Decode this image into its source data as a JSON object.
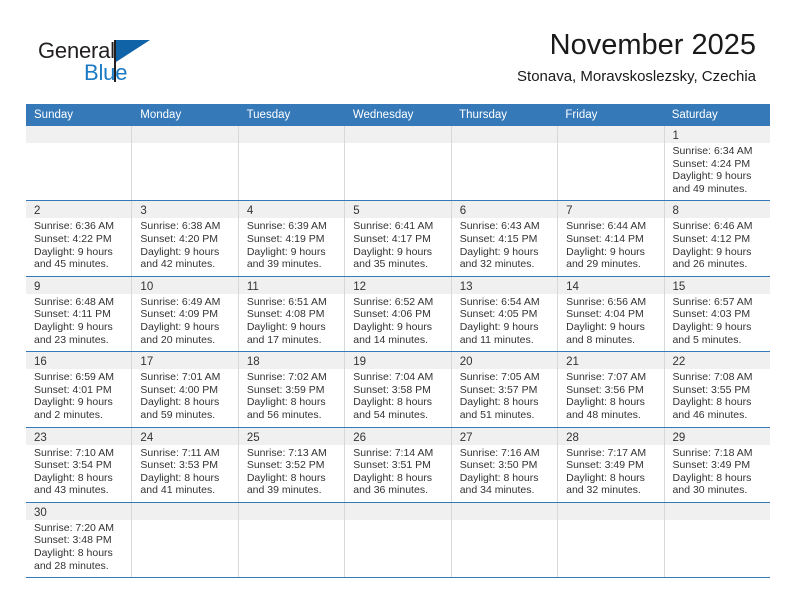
{
  "brand": {
    "name_line1": "General",
    "name_line2": "Blue",
    "primary_color": "#1163a8",
    "accent_color": "#1b7ac4"
  },
  "header": {
    "title": "November 2025",
    "subtitle": "Stonava, Moravskoslezsky, Czechia"
  },
  "calendar": {
    "header_bg": "#3579b8",
    "day_band_bg": "#f0f0f0",
    "weekdays": [
      "Sunday",
      "Monday",
      "Tuesday",
      "Wednesday",
      "Thursday",
      "Friday",
      "Saturday"
    ],
    "weeks": [
      [
        {
          "day": "",
          "empty": true
        },
        {
          "day": "",
          "empty": true
        },
        {
          "day": "",
          "empty": true
        },
        {
          "day": "",
          "empty": true
        },
        {
          "day": "",
          "empty": true
        },
        {
          "day": "",
          "empty": true
        },
        {
          "day": "1",
          "sunrise": "Sunrise: 6:34 AM",
          "sunset": "Sunset: 4:24 PM",
          "daylight_line1": "Daylight: 9 hours",
          "daylight_line2": "and 49 minutes."
        }
      ],
      [
        {
          "day": "2",
          "sunrise": "Sunrise: 6:36 AM",
          "sunset": "Sunset: 4:22 PM",
          "daylight_line1": "Daylight: 9 hours",
          "daylight_line2": "and 45 minutes."
        },
        {
          "day": "3",
          "sunrise": "Sunrise: 6:38 AM",
          "sunset": "Sunset: 4:20 PM",
          "daylight_line1": "Daylight: 9 hours",
          "daylight_line2": "and 42 minutes."
        },
        {
          "day": "4",
          "sunrise": "Sunrise: 6:39 AM",
          "sunset": "Sunset: 4:19 PM",
          "daylight_line1": "Daylight: 9 hours",
          "daylight_line2": "and 39 minutes."
        },
        {
          "day": "5",
          "sunrise": "Sunrise: 6:41 AM",
          "sunset": "Sunset: 4:17 PM",
          "daylight_line1": "Daylight: 9 hours",
          "daylight_line2": "and 35 minutes."
        },
        {
          "day": "6",
          "sunrise": "Sunrise: 6:43 AM",
          "sunset": "Sunset: 4:15 PM",
          "daylight_line1": "Daylight: 9 hours",
          "daylight_line2": "and 32 minutes."
        },
        {
          "day": "7",
          "sunrise": "Sunrise: 6:44 AM",
          "sunset": "Sunset: 4:14 PM",
          "daylight_line1": "Daylight: 9 hours",
          "daylight_line2": "and 29 minutes."
        },
        {
          "day": "8",
          "sunrise": "Sunrise: 6:46 AM",
          "sunset": "Sunset: 4:12 PM",
          "daylight_line1": "Daylight: 9 hours",
          "daylight_line2": "and 26 minutes."
        }
      ],
      [
        {
          "day": "9",
          "sunrise": "Sunrise: 6:48 AM",
          "sunset": "Sunset: 4:11 PM",
          "daylight_line1": "Daylight: 9 hours",
          "daylight_line2": "and 23 minutes."
        },
        {
          "day": "10",
          "sunrise": "Sunrise: 6:49 AM",
          "sunset": "Sunset: 4:09 PM",
          "daylight_line1": "Daylight: 9 hours",
          "daylight_line2": "and 20 minutes."
        },
        {
          "day": "11",
          "sunrise": "Sunrise: 6:51 AM",
          "sunset": "Sunset: 4:08 PM",
          "daylight_line1": "Daylight: 9 hours",
          "daylight_line2": "and 17 minutes."
        },
        {
          "day": "12",
          "sunrise": "Sunrise: 6:52 AM",
          "sunset": "Sunset: 4:06 PM",
          "daylight_line1": "Daylight: 9 hours",
          "daylight_line2": "and 14 minutes."
        },
        {
          "day": "13",
          "sunrise": "Sunrise: 6:54 AM",
          "sunset": "Sunset: 4:05 PM",
          "daylight_line1": "Daylight: 9 hours",
          "daylight_line2": "and 11 minutes."
        },
        {
          "day": "14",
          "sunrise": "Sunrise: 6:56 AM",
          "sunset": "Sunset: 4:04 PM",
          "daylight_line1": "Daylight: 9 hours",
          "daylight_line2": "and 8 minutes."
        },
        {
          "day": "15",
          "sunrise": "Sunrise: 6:57 AM",
          "sunset": "Sunset: 4:03 PM",
          "daylight_line1": "Daylight: 9 hours",
          "daylight_line2": "and 5 minutes."
        }
      ],
      [
        {
          "day": "16",
          "sunrise": "Sunrise: 6:59 AM",
          "sunset": "Sunset: 4:01 PM",
          "daylight_line1": "Daylight: 9 hours",
          "daylight_line2": "and 2 minutes."
        },
        {
          "day": "17",
          "sunrise": "Sunrise: 7:01 AM",
          "sunset": "Sunset: 4:00 PM",
          "daylight_line1": "Daylight: 8 hours",
          "daylight_line2": "and 59 minutes."
        },
        {
          "day": "18",
          "sunrise": "Sunrise: 7:02 AM",
          "sunset": "Sunset: 3:59 PM",
          "daylight_line1": "Daylight: 8 hours",
          "daylight_line2": "and 56 minutes."
        },
        {
          "day": "19",
          "sunrise": "Sunrise: 7:04 AM",
          "sunset": "Sunset: 3:58 PM",
          "daylight_line1": "Daylight: 8 hours",
          "daylight_line2": "and 54 minutes."
        },
        {
          "day": "20",
          "sunrise": "Sunrise: 7:05 AM",
          "sunset": "Sunset: 3:57 PM",
          "daylight_line1": "Daylight: 8 hours",
          "daylight_line2": "and 51 minutes."
        },
        {
          "day": "21",
          "sunrise": "Sunrise: 7:07 AM",
          "sunset": "Sunset: 3:56 PM",
          "daylight_line1": "Daylight: 8 hours",
          "daylight_line2": "and 48 minutes."
        },
        {
          "day": "22",
          "sunrise": "Sunrise: 7:08 AM",
          "sunset": "Sunset: 3:55 PM",
          "daylight_line1": "Daylight: 8 hours",
          "daylight_line2": "and 46 minutes."
        }
      ],
      [
        {
          "day": "23",
          "sunrise": "Sunrise: 7:10 AM",
          "sunset": "Sunset: 3:54 PM",
          "daylight_line1": "Daylight: 8 hours",
          "daylight_line2": "and 43 minutes."
        },
        {
          "day": "24",
          "sunrise": "Sunrise: 7:11 AM",
          "sunset": "Sunset: 3:53 PM",
          "daylight_line1": "Daylight: 8 hours",
          "daylight_line2": "and 41 minutes."
        },
        {
          "day": "25",
          "sunrise": "Sunrise: 7:13 AM",
          "sunset": "Sunset: 3:52 PM",
          "daylight_line1": "Daylight: 8 hours",
          "daylight_line2": "and 39 minutes."
        },
        {
          "day": "26",
          "sunrise": "Sunrise: 7:14 AM",
          "sunset": "Sunset: 3:51 PM",
          "daylight_line1": "Daylight: 8 hours",
          "daylight_line2": "and 36 minutes."
        },
        {
          "day": "27",
          "sunrise": "Sunrise: 7:16 AM",
          "sunset": "Sunset: 3:50 PM",
          "daylight_line1": "Daylight: 8 hours",
          "daylight_line2": "and 34 minutes."
        },
        {
          "day": "28",
          "sunrise": "Sunrise: 7:17 AM",
          "sunset": "Sunset: 3:49 PM",
          "daylight_line1": "Daylight: 8 hours",
          "daylight_line2": "and 32 minutes."
        },
        {
          "day": "29",
          "sunrise": "Sunrise: 7:18 AM",
          "sunset": "Sunset: 3:49 PM",
          "daylight_line1": "Daylight: 8 hours",
          "daylight_line2": "and 30 minutes."
        }
      ],
      [
        {
          "day": "30",
          "sunrise": "Sunrise: 7:20 AM",
          "sunset": "Sunset: 3:48 PM",
          "daylight_line1": "Daylight: 8 hours",
          "daylight_line2": "and 28 minutes."
        },
        {
          "day": "",
          "empty": true
        },
        {
          "day": "",
          "empty": true
        },
        {
          "day": "",
          "empty": true
        },
        {
          "day": "",
          "empty": true
        },
        {
          "day": "",
          "empty": true
        },
        {
          "day": "",
          "empty": true
        }
      ]
    ]
  }
}
